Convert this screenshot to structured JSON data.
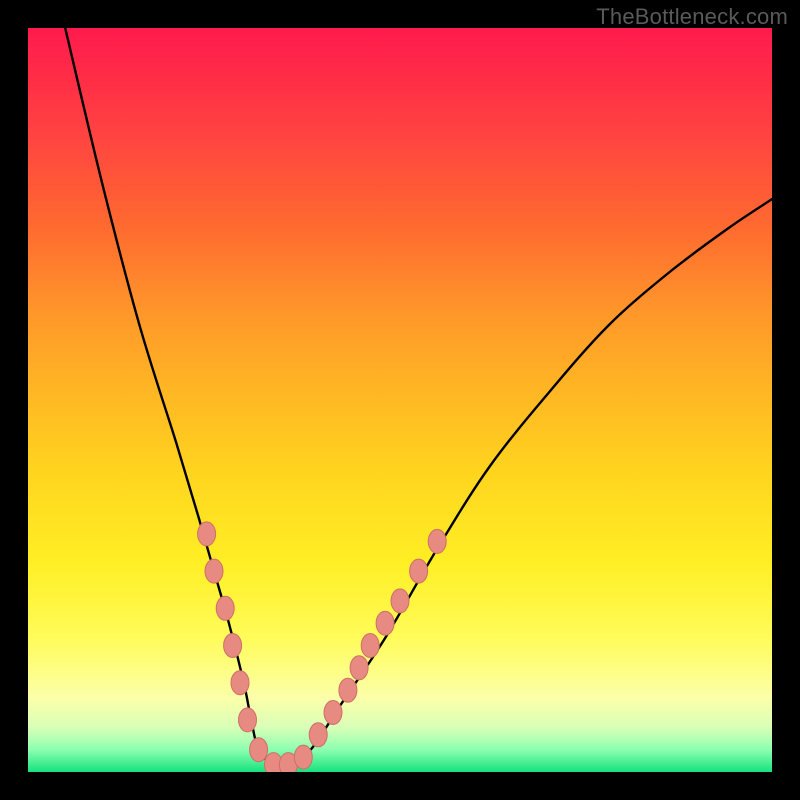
{
  "watermark": "TheBottleneck.com",
  "colors": {
    "curve": "#000000",
    "marker_fill": "#e78a82",
    "marker_stroke": "#cf6f67",
    "background_black": "#000000"
  },
  "chart_data": {
    "type": "line",
    "title": "",
    "xlabel": "",
    "ylabel": "",
    "xlim": [
      0,
      100
    ],
    "ylim": [
      0,
      100
    ],
    "grid": false,
    "legend": false,
    "annotations": [
      "TheBottleneck.com"
    ],
    "series": [
      {
        "name": "bottleneck-curve",
        "x": [
          5,
          10,
          15,
          20,
          23,
          25,
          27,
          29,
          30,
          31,
          33,
          35,
          38,
          42,
          48,
          55,
          62,
          70,
          78,
          86,
          94,
          100
        ],
        "values": [
          100,
          79,
          60,
          44,
          34,
          27,
          20,
          12,
          7,
          3,
          1,
          1,
          3,
          9,
          18,
          30,
          41,
          51,
          60,
          67,
          73,
          77
        ]
      }
    ],
    "markers": {
      "name": "highlight-points",
      "points": [
        {
          "x": 24,
          "y": 32
        },
        {
          "x": 25,
          "y": 27
        },
        {
          "x": 26.5,
          "y": 22
        },
        {
          "x": 27.5,
          "y": 17
        },
        {
          "x": 28.5,
          "y": 12
        },
        {
          "x": 29.5,
          "y": 7
        },
        {
          "x": 31,
          "y": 3
        },
        {
          "x": 33,
          "y": 1
        },
        {
          "x": 35,
          "y": 1
        },
        {
          "x": 37,
          "y": 2
        },
        {
          "x": 39,
          "y": 5
        },
        {
          "x": 41,
          "y": 8
        },
        {
          "x": 43,
          "y": 11
        },
        {
          "x": 44.5,
          "y": 14
        },
        {
          "x": 46,
          "y": 17
        },
        {
          "x": 48,
          "y": 20
        },
        {
          "x": 50,
          "y": 23
        },
        {
          "x": 52.5,
          "y": 27
        },
        {
          "x": 55,
          "y": 31
        }
      ]
    }
  }
}
